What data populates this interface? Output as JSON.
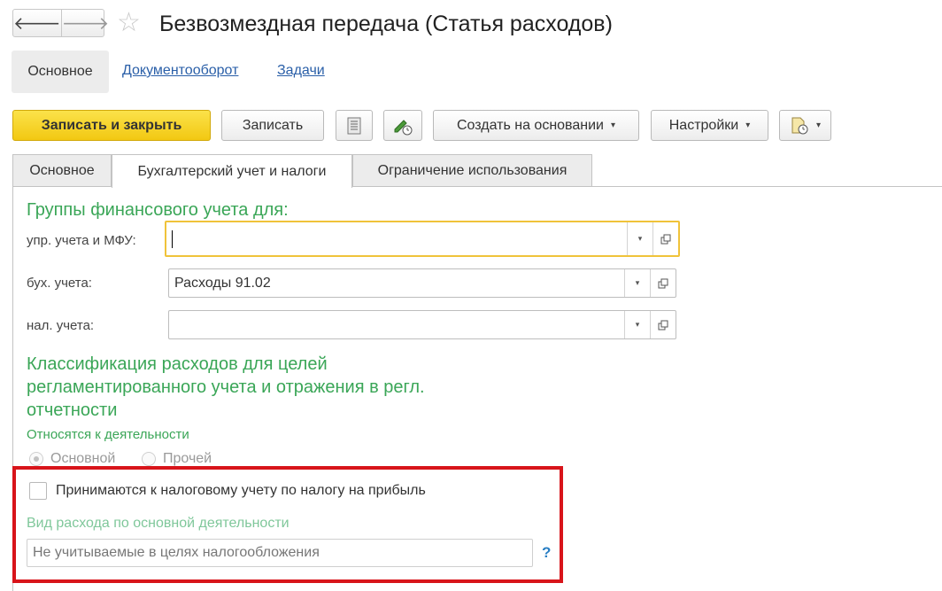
{
  "window": {
    "title": "Безвозмездная передача (Статья расходов)",
    "back_glyph": "🡐",
    "forward_glyph": "🡒",
    "star_glyph": "☆"
  },
  "top_tabs": {
    "main": "Основное",
    "docflow": "Документооборот",
    "tasks": "Задачи"
  },
  "toolbar": {
    "save_close": "Записать и закрыть",
    "save": "Записать",
    "create_based": "Создать на основании",
    "settings": "Настройки",
    "dropdown_glyph": "▾"
  },
  "form_tabs": {
    "main": "Основное",
    "accounting": "Бухгалтерский учет и налоги",
    "restriction": "Ограничение использования"
  },
  "groups": {
    "heading": "Группы финансового учета для:",
    "mgmt_label": "упр. учета и МФУ:",
    "mgmt_value": "",
    "acc_label": "бух. учета:",
    "acc_value": "Расходы 91.02",
    "tax_label": "нал. учета:",
    "tax_value": "",
    "dropdown_glyph": "▾"
  },
  "classification": {
    "heading_line1": "Классификация расходов для целей",
    "heading_line2": "регламентированного учета и отражения в регл.",
    "heading_line3": "отчетности",
    "activity_label": "Относятся к деятельности",
    "radio_main": "Основной",
    "radio_other": "Прочей",
    "selected": "Основной"
  },
  "tax": {
    "checkbox_label": "Принимаются к налоговому учету по налогу на прибыль",
    "checked": false,
    "kind_label": "Вид расхода по основной деятельности",
    "kind_value": "Не учитываемые в целях налогообложения",
    "help_glyph": "?"
  },
  "colors": {
    "accent_green": "#3aa657",
    "link_blue": "#2a5fa8",
    "primary_yellow": "#f2c812",
    "highlight_red": "#d8141a"
  },
  "icons": {
    "list": "list-icon",
    "edit": "pencil-clock-icon",
    "report": "document-clock-icon",
    "open": "open-window-icon"
  }
}
